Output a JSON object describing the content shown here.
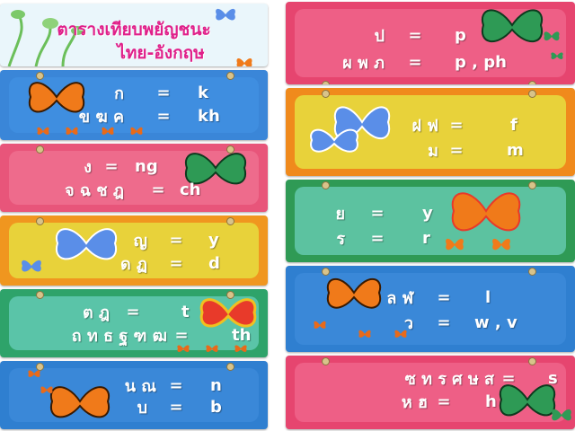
{
  "title": {
    "line1": "ตารางเทียบพยัญชนะ",
    "line2": "ไทย-อังกฤษ"
  },
  "eq_sign": "=",
  "left_panels": [
    {
      "color": "#3a86d8",
      "inner": "#3f8ee0",
      "rows": [
        {
          "th": "ก",
          "en": "k"
        },
        {
          "th": "ข ฆ ค",
          "en": "kh"
        }
      ]
    },
    {
      "color": "#e8557a",
      "inner": "#ee6b8c",
      "rows": [
        {
          "th": "ง",
          "en": "ng"
        },
        {
          "th": "จ ฉ ช ฎ",
          "en": "ch"
        }
      ]
    },
    {
      "color": "#f0961f",
      "inner": "#e8d23a",
      "rows": [
        {
          "th": "ญ",
          "en": "y"
        },
        {
          "th": "ด ฏ",
          "en": "d"
        }
      ]
    },
    {
      "color": "#2ea36a",
      "inner": "#5ac4a8",
      "rows": [
        {
          "th": "ต ฎ",
          "en": "t"
        },
        {
          "th": "ถ ท ธ ฐ ฑ ฒ",
          "en": "th"
        }
      ]
    },
    {
      "color": "#2f7fd0",
      "inner": "#3a88d8",
      "rows": [
        {
          "th": "น ณ",
          "en": "n"
        },
        {
          "th": "บ",
          "en": "b"
        }
      ]
    }
  ],
  "right_panels": [
    {
      "color": "#e6456f",
      "inner": "#ee5f86",
      "rows": [
        {
          "th": "ป",
          "en": "p"
        },
        {
          "th": "ผ พ ภ",
          "en": "p , ph"
        }
      ]
    },
    {
      "color": "#f08a1c",
      "inner": "#e8d23a",
      "rows": [
        {
          "th": "ฝ ฟ",
          "en": "f"
        },
        {
          "th": "ม",
          "en": "m"
        }
      ]
    },
    {
      "color": "#2f9a55",
      "inner": "#5cc2a0",
      "rows": [
        {
          "th": "ย",
          "en": "y"
        },
        {
          "th": "ร",
          "en": "r"
        }
      ]
    },
    {
      "color": "#2f7fd0",
      "inner": "#3a88d8",
      "rows": [
        {
          "th": "ล ฬ",
          "en": "l"
        },
        {
          "th": "ว",
          "en": "w , v"
        }
      ]
    },
    {
      "color": "#e6456f",
      "inner": "#ee5f86",
      "rows": [
        {
          "th": "ซ ท ร ศ ษ ส",
          "en": "s"
        },
        {
          "th": "ห ฮ",
          "en": "h"
        }
      ]
    }
  ],
  "colors": {
    "title_bg": "#eaf6fb",
    "title_text": "#e0208a",
    "butterfly_orange": "#f07a1a",
    "butterfly_blue": "#5a8ee8",
    "butterfly_green": "#2e9a55",
    "butterfly_red": "#e83a2a"
  },
  "icons": [
    "butterfly-icon"
  ]
}
